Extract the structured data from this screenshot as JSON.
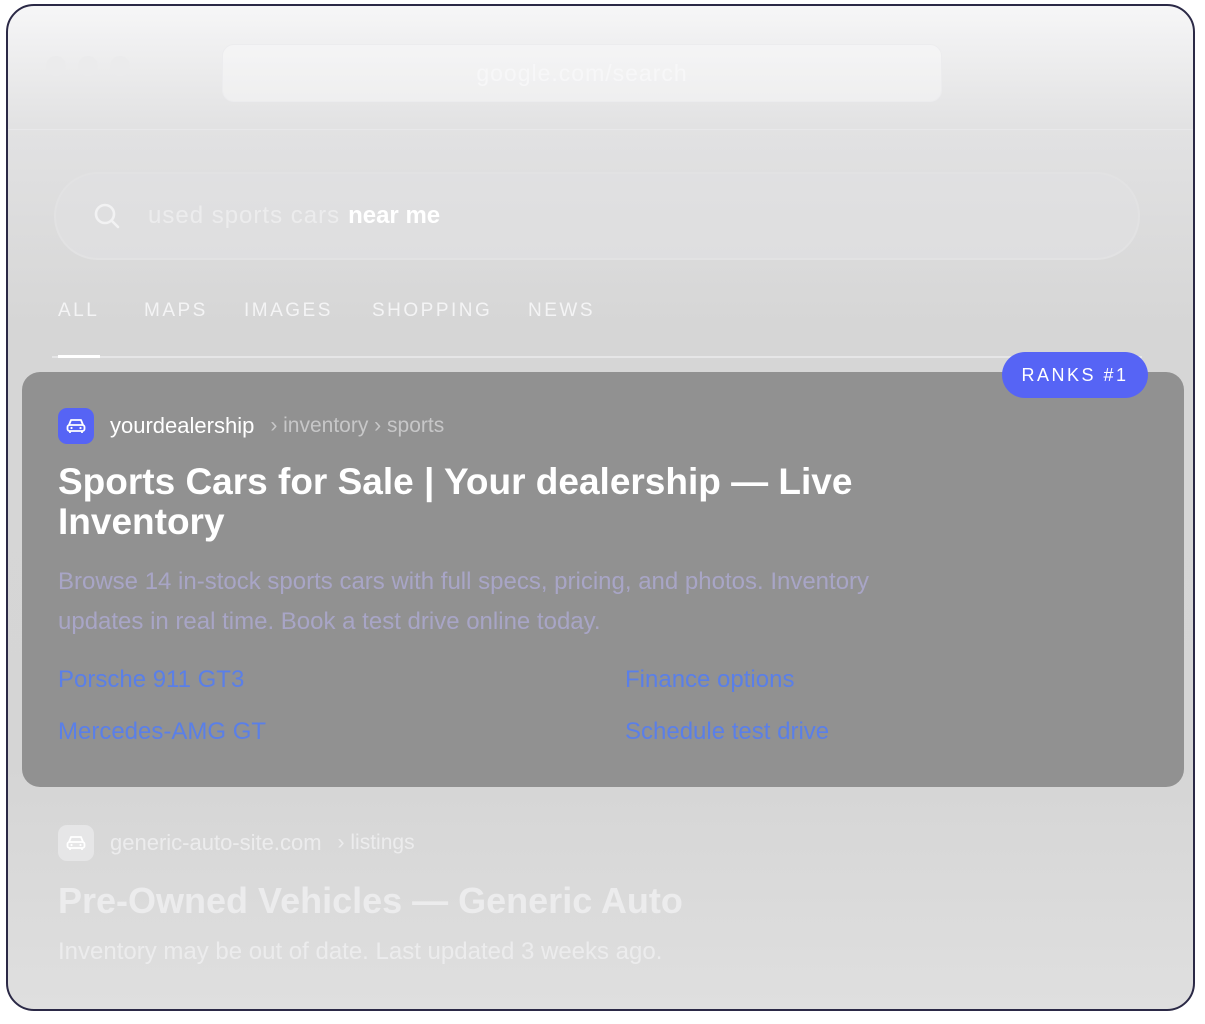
{
  "browser": {
    "url": "google.com/search"
  },
  "search": {
    "query_muted": "used sports cars",
    "query_bold": "near me"
  },
  "tabs": [
    {
      "label": "ALL"
    },
    {
      "label": "MAPS"
    },
    {
      "label": "IMAGES"
    },
    {
      "label": "SHOPPING"
    },
    {
      "label": "NEWS"
    }
  ],
  "badge": {
    "label": "RANKS #1"
  },
  "results": [
    {
      "site": "yourdealership",
      "breadcrumb": "› inventory › sports",
      "title": "Sports Cars for Sale | Your dealership  — Live Inventory",
      "description": "Browse 14 in-stock sports cars with full specs, pricing, and photos. Inventory updates in real time. Book a test drive online today.",
      "sitelinks": [
        {
          "label": "Porsche 911 GT3"
        },
        {
          "label": "Finance options"
        },
        {
          "label": "Mercedes-AMG GT"
        },
        {
          "label": "Schedule test drive"
        }
      ]
    },
    {
      "site": "generic-auto-site.com",
      "breadcrumb": "› listings",
      "title": "Pre-Owned Vehicles — Generic Auto",
      "description": "Inventory may be out of date. Last updated 3 weeks ago."
    }
  ],
  "colors": {
    "accent": "#5664f5",
    "link": "#5a7fe8",
    "highlight_card": "#919191"
  }
}
